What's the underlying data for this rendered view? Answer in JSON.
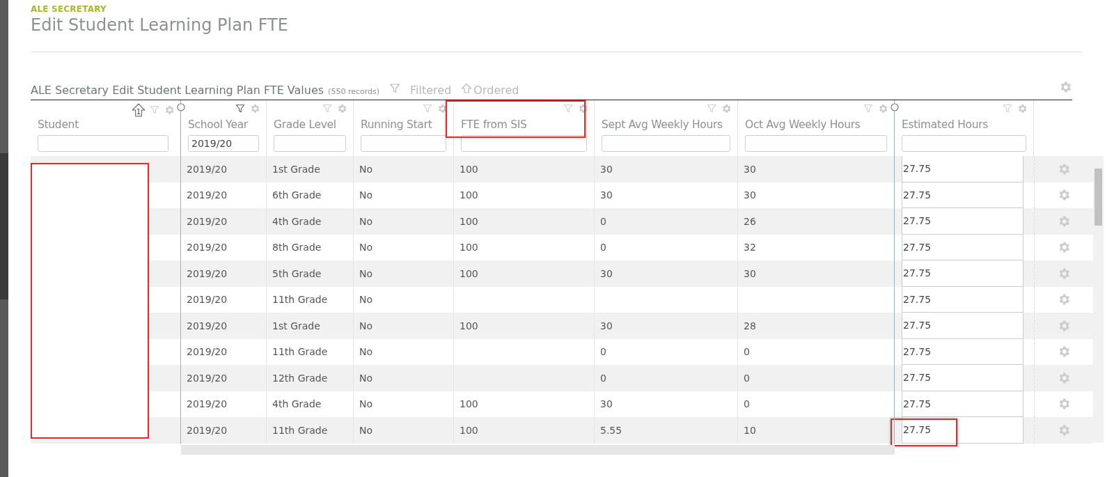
{
  "breadcrumb": "ALE SECRETARY",
  "title": "Edit Student Learning Plan FTE",
  "grid": {
    "title": "ALE Secretary Edit Student Learning Plan FTE Values",
    "record_count": "(550 records)",
    "filtered_label": "Filtered",
    "ordered_label": "Ordered",
    "student_redacted": true,
    "columns": [
      {
        "label": "Student",
        "sort": "1",
        "filtered": false,
        "freeze_handle": true,
        "highlighted": false
      },
      {
        "label": "School Year",
        "filter_value": "2019/20",
        "filtered": true,
        "freeze_handle": false,
        "highlighted": false
      },
      {
        "label": "Grade Level",
        "filtered": false,
        "freeze_handle": false,
        "highlighted": false
      },
      {
        "label": "Running Start",
        "filtered": false,
        "freeze_handle": false,
        "highlighted": false
      },
      {
        "label": "FTE from SIS",
        "filtered": false,
        "freeze_handle": false,
        "highlighted": true
      },
      {
        "label": "Sept Avg Weekly Hours",
        "filtered": false,
        "freeze_handle": false,
        "highlighted": false
      },
      {
        "label": "Oct Avg Weekly Hours",
        "filtered": false,
        "freeze_handle": true,
        "highlighted": false
      },
      {
        "label": "Estimated Hours",
        "filtered": false,
        "freeze_handle": false,
        "highlighted": false
      }
    ],
    "rows": [
      {
        "year": "2019/20",
        "grade": "1st Grade",
        "running_start": "No",
        "fte": "100",
        "sept": "30",
        "oct": "30",
        "hours": "27.75",
        "highlighted": false
      },
      {
        "year": "2019/20",
        "grade": "6th Grade",
        "running_start": "No",
        "fte": "100",
        "sept": "30",
        "oct": "30",
        "hours": "27.75",
        "highlighted": false
      },
      {
        "year": "2019/20",
        "grade": "4th Grade",
        "running_start": "No",
        "fte": "100",
        "sept": "0",
        "oct": "26",
        "hours": "27.75",
        "highlighted": false
      },
      {
        "year": "2019/20",
        "grade": "8th Grade",
        "running_start": "No",
        "fte": "100",
        "sept": "0",
        "oct": "32",
        "hours": "27.75",
        "highlighted": false
      },
      {
        "year": "2019/20",
        "grade": "5th Grade",
        "running_start": "No",
        "fte": "100",
        "sept": "30",
        "oct": "30",
        "hours": "27.75",
        "highlighted": false
      },
      {
        "year": "2019/20",
        "grade": "11th Grade",
        "running_start": "No",
        "hours": "27.75",
        "highlighted": false
      },
      {
        "year": "2019/20",
        "grade": "1st Grade",
        "running_start": "No",
        "fte": "100",
        "sept": "30",
        "oct": "28",
        "hours": "27.75",
        "highlighted": false
      },
      {
        "year": "2019/20",
        "grade": "11th Grade",
        "running_start": "No",
        "sept": "0",
        "oct": "0",
        "hours": "27.75",
        "highlighted": false
      },
      {
        "year": "2019/20",
        "grade": "12th Grade",
        "running_start": "No",
        "sept": "0",
        "oct": "0",
        "hours": "27.75",
        "highlighted": false
      },
      {
        "year": "2019/20",
        "grade": "4th Grade",
        "running_start": "No",
        "fte": "100",
        "sept": "30",
        "oct": "0",
        "hours": "27.75",
        "highlighted": false
      },
      {
        "year": "2019/20",
        "grade": "11th Grade",
        "running_start": "No",
        "fte": "100",
        "sept": "5.55",
        "oct": "10",
        "hours": "27.75",
        "highlighted": true
      }
    ]
  }
}
